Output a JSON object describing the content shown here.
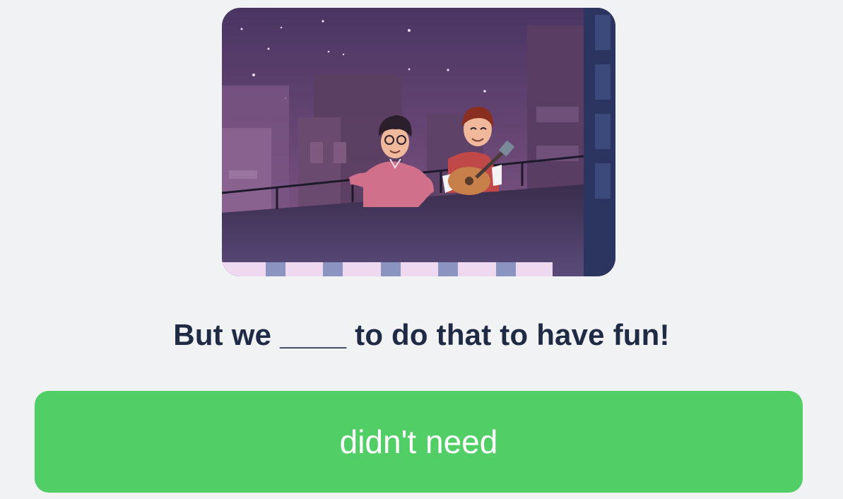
{
  "exercise": {
    "illustration_name": "rooftop-guitar-scene",
    "prompt": "But we ____ to do that to have fun!",
    "answer_option": "didn't need"
  },
  "colors": {
    "background": "#f1f2f4",
    "prompt_text": "#1f2b45",
    "answer_button": "#51cf66",
    "answer_text": "#ffffff"
  }
}
